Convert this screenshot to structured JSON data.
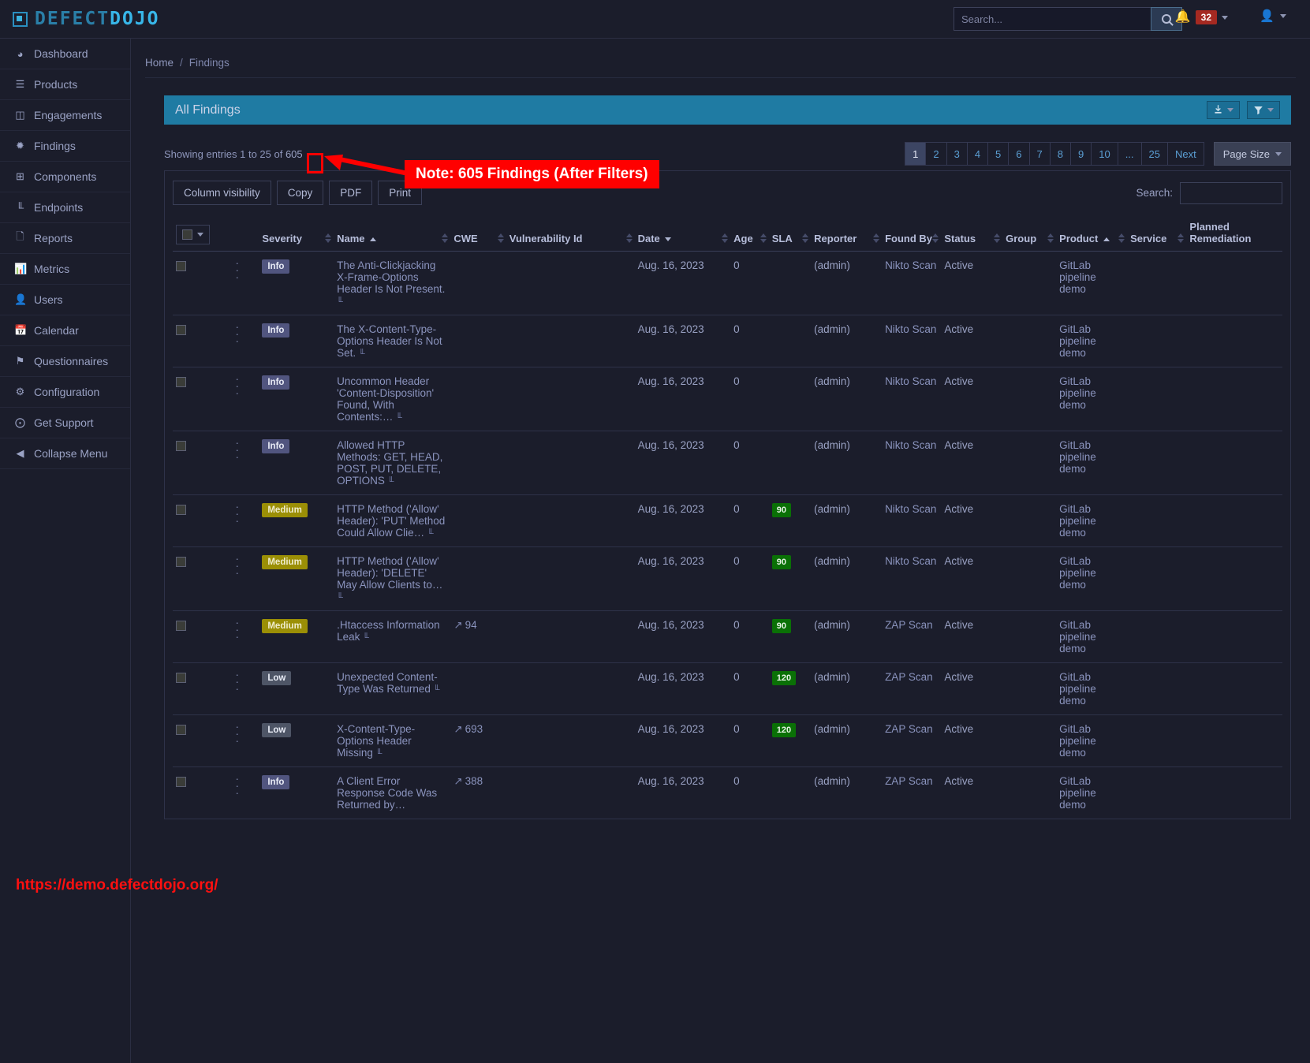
{
  "brand": {
    "defect": "DEFECT",
    "dojo": "DOJO",
    "logo_icon": "defectdojo-logo-icon"
  },
  "topbar": {
    "search_placeholder": "Search...",
    "search_value": "",
    "search_icon": "search-icon",
    "bell_icon": "bell-icon",
    "notification_count": "32",
    "user_icon": "user-icon",
    "caret_icon": "chevron-down-icon"
  },
  "sidebar": {
    "items": [
      {
        "label": "Dashboard",
        "icon": "dashboard-icon",
        "glyph": "◔"
      },
      {
        "label": "Products",
        "icon": "list-icon",
        "glyph": "☰"
      },
      {
        "label": "Engagements",
        "icon": "inbox-icon",
        "glyph": "☐"
      },
      {
        "label": "Findings",
        "icon": "bug-icon",
        "glyph": "✹"
      },
      {
        "label": "Components",
        "icon": "grid-icon",
        "glyph": "⊞"
      },
      {
        "label": "Endpoints",
        "icon": "sitemap-icon",
        "glyph": "⛓"
      },
      {
        "label": "Reports",
        "icon": "document-icon",
        "glyph": "☰"
      },
      {
        "label": "Metrics",
        "icon": "bar-chart-icon",
        "glyph": "█"
      },
      {
        "label": "Users",
        "icon": "user-icon",
        "glyph": "☺"
      },
      {
        "label": "Calendar",
        "icon": "calendar-icon",
        "glyph": "☷"
      },
      {
        "label": "Questionnaires",
        "icon": "clipboard-flag-icon",
        "glyph": "⚑"
      },
      {
        "label": "Configuration",
        "icon": "gear-icon",
        "glyph": "⚙"
      },
      {
        "label": "Get Support",
        "icon": "lifebuoy-icon",
        "glyph": "⨀"
      },
      {
        "label": "Collapse Menu",
        "icon": "collapse-left-icon",
        "glyph": "◀"
      }
    ]
  },
  "breadcrumb": {
    "home": "Home",
    "separator": "/",
    "current": "Findings"
  },
  "panel": {
    "title": "All Findings",
    "download_icon": "download-icon",
    "filter_icon": "filter-icon",
    "caret_icon": "chevron-down-icon"
  },
  "showing": {
    "prefix": "Showing entries 1 to 25 of",
    "total": "605"
  },
  "pagination": {
    "pages": [
      "1",
      "2",
      "3",
      "4",
      "5",
      "6",
      "7",
      "8",
      "9",
      "10",
      "...",
      "25",
      "Next"
    ],
    "active": "1",
    "page_size_label": "Page Size"
  },
  "toolbar": {
    "buttons": [
      "Column visibility",
      "Copy",
      "PDF",
      "Print"
    ],
    "search_label": "Search:",
    "search_value": "",
    "search_placeholder": ""
  },
  "table": {
    "columns": [
      {
        "label": "",
        "sortable": false,
        "key": "select"
      },
      {
        "label": "",
        "sortable": false,
        "key": "menu"
      },
      {
        "label": "Severity",
        "sortable": true,
        "sorted": "none"
      },
      {
        "label": "Name",
        "sortable": true,
        "sorted": "asc"
      },
      {
        "label": "CWE",
        "sortable": true,
        "sorted": "none"
      },
      {
        "label": "Vulnerability Id",
        "sortable": true,
        "sorted": "none"
      },
      {
        "label": "Date",
        "sortable": true,
        "sorted": "desc"
      },
      {
        "label": "Age",
        "sortable": true,
        "sorted": "none"
      },
      {
        "label": "SLA",
        "sortable": true,
        "sorted": "none"
      },
      {
        "label": "Reporter",
        "sortable": true,
        "sorted": "none"
      },
      {
        "label": "Found By",
        "sortable": true,
        "sorted": "none"
      },
      {
        "label": "Status",
        "sortable": true,
        "sorted": "none"
      },
      {
        "label": "Group",
        "sortable": true,
        "sorted": "none"
      },
      {
        "label": "Product",
        "sortable": true,
        "sorted": "asc"
      },
      {
        "label": "Service",
        "sortable": true,
        "sorted": "none"
      },
      {
        "label": "Planned Remediation",
        "sortable": true,
        "sorted": "none"
      }
    ],
    "rows": [
      {
        "severity": "Info",
        "sev_class": "sev-info",
        "name": "The Anti-Clickjacking X-Frame-Options Header Is Not Present.",
        "has_tree": true,
        "cwe": "",
        "vuln_id": "",
        "date": "Aug. 16, 2023",
        "age": "0",
        "sla": "",
        "reporter": "(admin)",
        "found_by": "Nikto Scan",
        "status": "Active",
        "group": "",
        "product": "GitLab pipeline demo",
        "service": "",
        "remediation": ""
      },
      {
        "severity": "Info",
        "sev_class": "sev-info",
        "name": "The X-Content-Type-Options Header Is Not Set.",
        "has_tree": true,
        "cwe": "",
        "vuln_id": "",
        "date": "Aug. 16, 2023",
        "age": "0",
        "sla": "",
        "reporter": "(admin)",
        "found_by": "Nikto Scan",
        "status": "Active",
        "group": "",
        "product": "GitLab pipeline demo",
        "service": "",
        "remediation": ""
      },
      {
        "severity": "Info",
        "sev_class": "sev-info",
        "name": "Uncommon Header 'Content-Disposition' Found, With Contents:…",
        "has_tree": true,
        "cwe": "",
        "vuln_id": "",
        "date": "Aug. 16, 2023",
        "age": "0",
        "sla": "",
        "reporter": "(admin)",
        "found_by": "Nikto Scan",
        "status": "Active",
        "group": "",
        "product": "GitLab pipeline demo",
        "service": "",
        "remediation": ""
      },
      {
        "severity": "Info",
        "sev_class": "sev-info",
        "name": "Allowed HTTP Methods: GET, HEAD, POST, PUT, DELETE, OPTIONS",
        "has_tree": true,
        "cwe": "",
        "vuln_id": "",
        "date": "Aug. 16, 2023",
        "age": "0",
        "sla": "",
        "reporter": "(admin)",
        "found_by": "Nikto Scan",
        "status": "Active",
        "group": "",
        "product": "GitLab pipeline demo",
        "service": "",
        "remediation": ""
      },
      {
        "severity": "Medium",
        "sev_class": "sev-medium",
        "name": "HTTP Method ('Allow' Header): 'PUT' Method Could Allow Clie…",
        "has_tree": true,
        "cwe": "",
        "vuln_id": "",
        "date": "Aug. 16, 2023",
        "age": "0",
        "sla": "90",
        "reporter": "(admin)",
        "found_by": "Nikto Scan",
        "status": "Active",
        "group": "",
        "product": "GitLab pipeline demo",
        "service": "",
        "remediation": ""
      },
      {
        "severity": "Medium",
        "sev_class": "sev-medium",
        "name": "HTTP Method ('Allow' Header): 'DELETE' May Allow Clients to…",
        "has_tree": true,
        "cwe": "",
        "vuln_id": "",
        "date": "Aug. 16, 2023",
        "age": "0",
        "sla": "90",
        "reporter": "(admin)",
        "found_by": "Nikto Scan",
        "status": "Active",
        "group": "",
        "product": "GitLab pipeline demo",
        "service": "",
        "remediation": ""
      },
      {
        "severity": "Medium",
        "sev_class": "sev-medium",
        "name": ".Htaccess Information Leak",
        "has_tree": true,
        "cwe": "94",
        "vuln_id": "",
        "date": "Aug. 16, 2023",
        "age": "0",
        "sla": "90",
        "reporter": "(admin)",
        "found_by": "ZAP Scan",
        "status": "Active",
        "group": "",
        "product": "GitLab pipeline demo",
        "service": "",
        "remediation": ""
      },
      {
        "severity": "Low",
        "sev_class": "sev-low",
        "name": "Unexpected Content-Type Was Returned",
        "has_tree": true,
        "cwe": "",
        "vuln_id": "",
        "date": "Aug. 16, 2023",
        "age": "0",
        "sla": "120",
        "reporter": "(admin)",
        "found_by": "ZAP Scan",
        "status": "Active",
        "group": "",
        "product": "GitLab pipeline demo",
        "service": "",
        "remediation": ""
      },
      {
        "severity": "Low",
        "sev_class": "sev-low",
        "name": "X-Content-Type-Options Header Missing",
        "has_tree": true,
        "cwe": "693",
        "vuln_id": "",
        "date": "Aug. 16, 2023",
        "age": "0",
        "sla": "120",
        "reporter": "(admin)",
        "found_by": "ZAP Scan",
        "status": "Active",
        "group": "",
        "product": "GitLab pipeline demo",
        "service": "",
        "remediation": ""
      },
      {
        "severity": "Info",
        "sev_class": "sev-info",
        "name": "A Client Error Response Code Was Returned by…",
        "has_tree": false,
        "cwe": "388",
        "vuln_id": "",
        "date": "Aug. 16, 2023",
        "age": "0",
        "sla": "",
        "reporter": "(admin)",
        "found_by": "ZAP Scan",
        "status": "Active",
        "group": "",
        "product": "GitLab pipeline demo",
        "service": "",
        "remediation": ""
      }
    ]
  },
  "annotations": {
    "note": "Note: 605 Findings (After Filters)",
    "url": "https://demo.defectdojo.org/",
    "highlight_color": "#ff0000"
  }
}
